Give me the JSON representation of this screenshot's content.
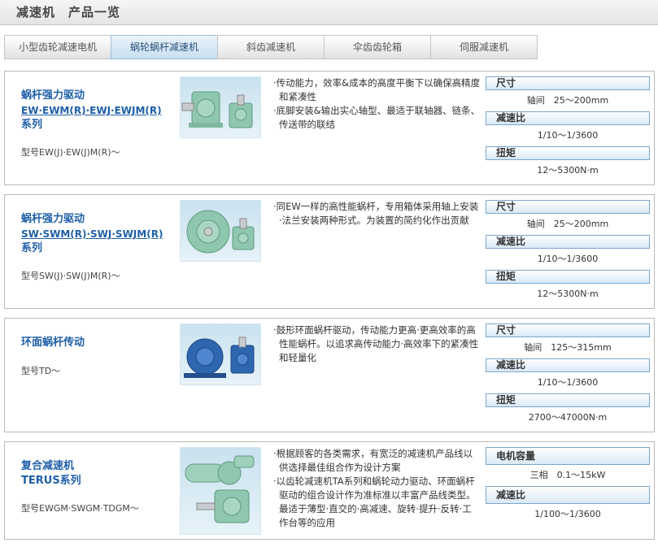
{
  "header": {
    "title": "减速机　产品一览"
  },
  "tabs": [
    {
      "label": "小型齿轮减速电机",
      "active": false
    },
    {
      "label": "蜗轮蜗杆减速机",
      "active": true
    },
    {
      "label": "斜齿减速机",
      "active": false
    },
    {
      "label": "伞齿齿轮箱",
      "active": false
    },
    {
      "label": "伺服减速机",
      "active": false
    }
  ],
  "products": [
    {
      "name_line1": "蜗杆强力驱动",
      "name_line2": "EW·EWM(R)·EWJ·EWJM(R)",
      "name_line3": "系列",
      "model": "型号EW(J)·EW(J)M(R)～",
      "desc": [
        "·传动能力，效率&成本的高度平衡下以确保高精度和紧凑性",
        "·底脚安装&输出实心轴型、最适于联轴器、链条、传送带的联结"
      ],
      "specs": [
        {
          "label": "尺寸",
          "value": "轴间　25～200mm"
        },
        {
          "label": "减速比",
          "value": "1/10～1/3600"
        },
        {
          "label": "扭矩",
          "value": "12～5300N·m"
        }
      ]
    },
    {
      "name_line1": "蜗杆强力驱动",
      "name_line2": "SW·SWM(R)·SWJ·SWJM(R)",
      "name_line3": "系列",
      "model": "型号SW(J)·SW(J)M(R)～",
      "desc": [
        "·同EW一样的高性能蜗杆，专用箱体采用轴上安装·法兰安装两种形式。为装置的简约化作出贡献"
      ],
      "specs": [
        {
          "label": "尺寸",
          "value": "轴间　25～200mm"
        },
        {
          "label": "减速比",
          "value": "1/10～1/3600"
        },
        {
          "label": "扭矩",
          "value": "12～5300N·m"
        }
      ]
    },
    {
      "name_line1": "环面蜗杆传动",
      "name_line2": "",
      "name_line3": "",
      "model": "型号TD～",
      "desc": [
        "·鼓形环面蜗杆驱动，传动能力更高·更高效率的高性能蜗杆。以追求高传动能力·高效率下的紧凑性和轻量化"
      ],
      "specs": [
        {
          "label": "尺寸",
          "value": "轴间　125～315mm"
        },
        {
          "label": "减速比",
          "value": "1/10～1/3600"
        },
        {
          "label": "扭矩",
          "value": "2700～47000N·m"
        }
      ]
    },
    {
      "name_line1": "复合减速机",
      "name_line2": "TERUS系列",
      "name_line3": "",
      "model": "型号EWGM·SWGM·TDGM～",
      "desc": [
        "·根据顾客的各类需求，有宽泛的减速机产品线以供选择最佳组合作为设计方案",
        "·以齿轮减速机TA系列和蜗轮动力驱动、环面蜗杆驱动的组合设计作为准标准以丰富产品线类型。最适于薄型·直交的·高减速、旋转·提升·反转·工作台等的应用"
      ],
      "specs": [
        {
          "label": "电机容量",
          "value": "三相　0.1～15kW"
        },
        {
          "label": "减速比",
          "value": "1/100～1/3600"
        }
      ]
    }
  ],
  "colors": {
    "accent": "#1f5fa8",
    "gear_green": "#8fc6ae",
    "gear_blue": "#2e66b0"
  }
}
